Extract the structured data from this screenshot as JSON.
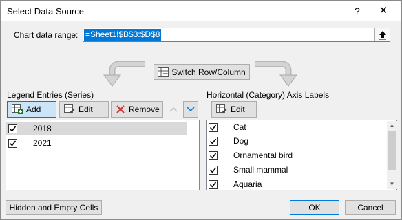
{
  "window": {
    "title": "Select Data Source",
    "help_glyph": "?",
    "close_glyph": "✕"
  },
  "chart_range": {
    "label": "Chart data range:",
    "value": "=Sheet1!$B$3:$D$8"
  },
  "switch_button": {
    "label": "Switch Row/Column",
    "underline_char": "W"
  },
  "legend": {
    "label": "Legend Entries (Series)",
    "add_label": "Add",
    "edit_label": "Edit",
    "remove_label": "Remove",
    "series": [
      {
        "name": "2018",
        "checked": true,
        "selected": true
      },
      {
        "name": "2021",
        "checked": true,
        "selected": false
      }
    ]
  },
  "axis": {
    "label": "Horizontal (Category) Axis Labels",
    "edit_label": "Edit",
    "categories": [
      {
        "name": "Cat",
        "checked": true
      },
      {
        "name": "Dog",
        "checked": true
      },
      {
        "name": "Ornamental bird",
        "checked": true
      },
      {
        "name": "Small mammal",
        "checked": true
      },
      {
        "name": "Aquaria",
        "checked": true
      }
    ]
  },
  "footer": {
    "hidden_label": "Hidden and Empty Cells",
    "ok_label": "OK",
    "cancel_label": "Cancel"
  },
  "colors": {
    "accent": "#0078d7",
    "remove_x": "#d13438",
    "arrow": "#8e8e8e"
  }
}
